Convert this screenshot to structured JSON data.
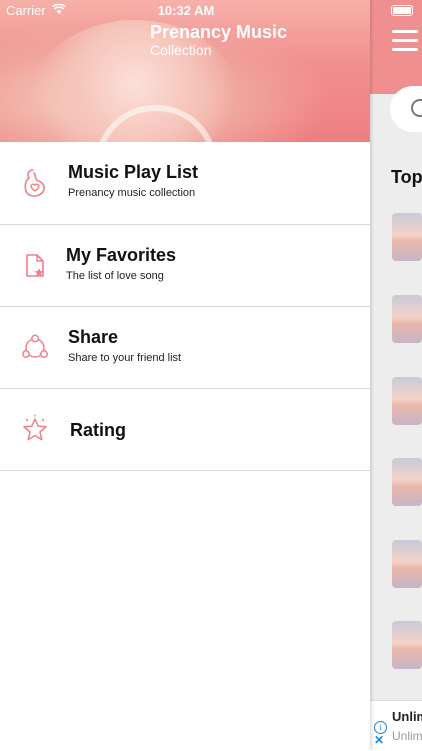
{
  "status_bar": {
    "carrier": "Carrier",
    "time": "10:32 AM"
  },
  "drawer": {
    "header": {
      "title": "Prenancy Music",
      "subtitle": "Collection"
    },
    "items": [
      {
        "title": "Music Play List",
        "subtitle": "Prenancy music collection",
        "icon": "pregnant-heart-icon"
      },
      {
        "title": "My Favorites",
        "subtitle": "The list of love song",
        "icon": "favorite-file-icon"
      },
      {
        "title": "Share",
        "subtitle": "Share to your friend list",
        "icon": "share-icon"
      },
      {
        "title": "Rating",
        "subtitle": "",
        "icon": "star-rating-icon"
      }
    ]
  },
  "background_screen": {
    "section_title": "Top",
    "ad": {
      "title": "Unlim",
      "subtitle": "Unlim"
    }
  },
  "colors": {
    "accent": "#f08f8f",
    "icon_pink": "#f07f8a",
    "ad_blue": "#1a8be0"
  }
}
